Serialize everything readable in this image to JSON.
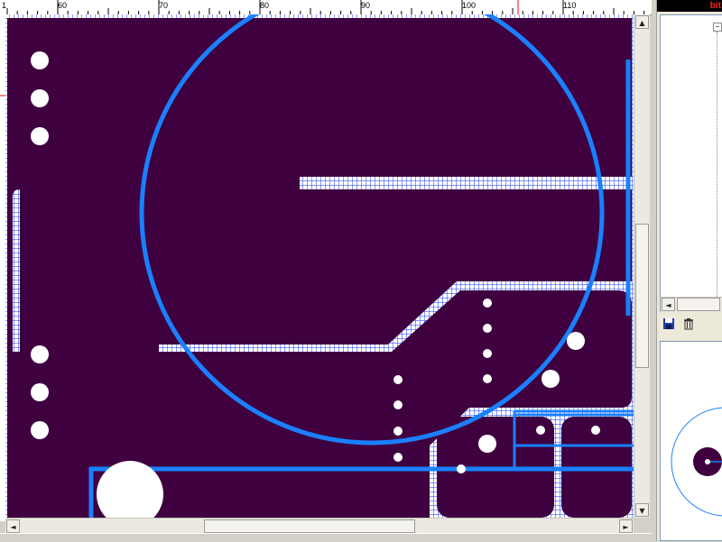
{
  "ruler": {
    "labels": [
      "60",
      "70",
      "80",
      "90",
      "100",
      "110"
    ],
    "left_label": "1"
  },
  "pcb": {
    "board_color": "#3f0040",
    "trace_color": "#1a80ff",
    "grid_color": "#1030ff",
    "pad_color": "#ffffff"
  },
  "scroll": {
    "up_arrow": "▲",
    "down_arrow": "▼",
    "left_arrow": "◄",
    "right_arrow": "►"
  },
  "panel": {
    "brand_text": "bit",
    "save_icon": "save-icon",
    "trash_icon": "trash-icon"
  }
}
